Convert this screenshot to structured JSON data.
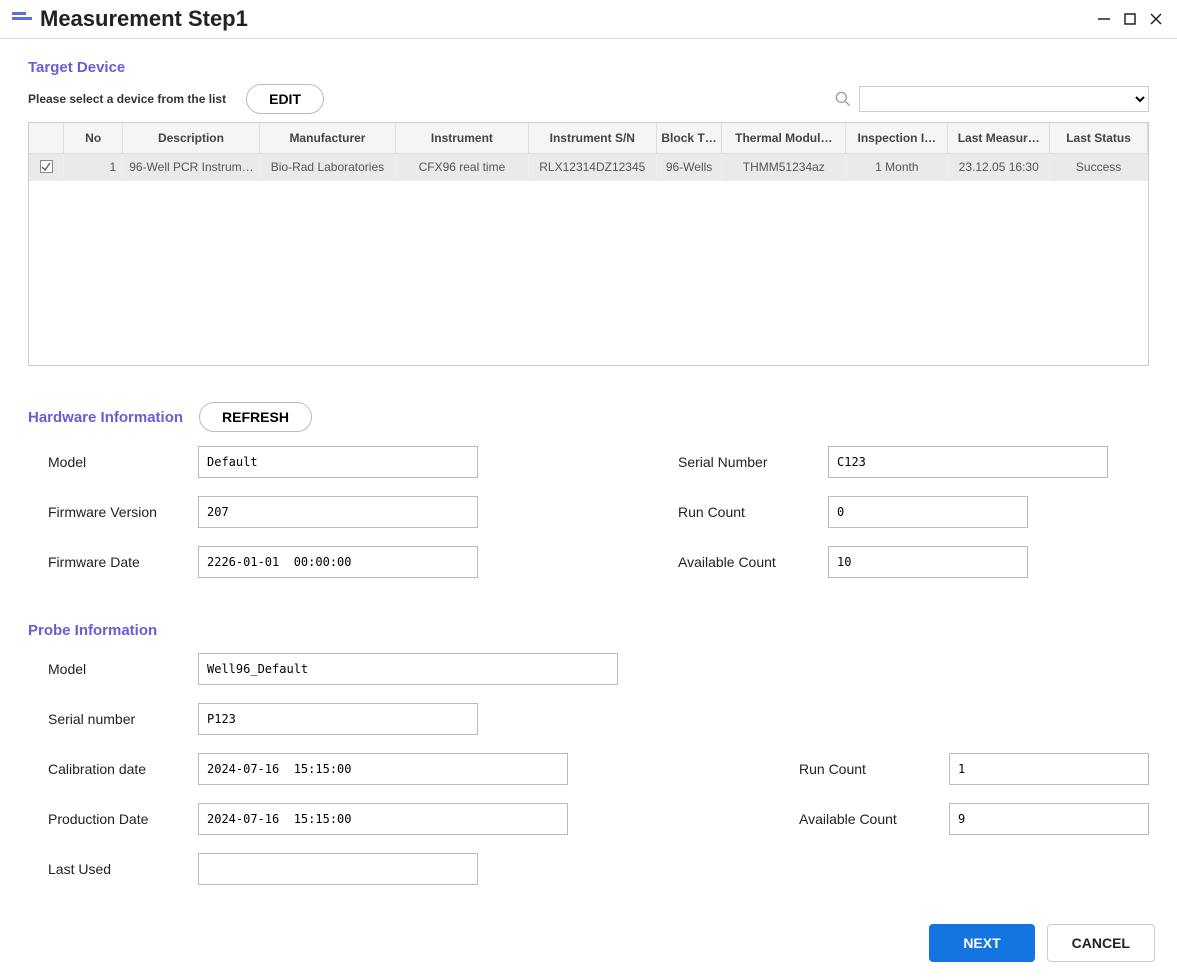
{
  "titlebar": {
    "title": "Measurement Step1"
  },
  "target": {
    "section_title": "Target Device",
    "instruction": "Please select a device from the list",
    "edit_button": "EDIT"
  },
  "table": {
    "headers": {
      "no": "No",
      "description": "Description",
      "manufacturer": "Manufacturer",
      "instrument": "Instrument",
      "instrument_sn": "Instrument S/N",
      "block_type": "Block T…",
      "thermal_module": "Thermal Modul…",
      "inspection": "Inspection I…",
      "last_measure": "Last Measur…",
      "last_status": "Last Status"
    },
    "rows": [
      {
        "checked": true,
        "no": "1",
        "description": "96-Well PCR Instrum…",
        "manufacturer": "Bio-Rad Laboratories",
        "instrument": "CFX96 real time",
        "instrument_sn": "RLX12314DZ12345",
        "block_type": "96-Wells",
        "thermal_module": "THMM51234az",
        "inspection": "1 Month",
        "last_measure": "23.12.05 16:30",
        "last_status": "Success"
      }
    ]
  },
  "hardware": {
    "section_title": "Hardware Information",
    "refresh_button": "REFRESH",
    "labels": {
      "model": "Model",
      "serial_number": "Serial Number",
      "firmware_version": "Firmware Version",
      "run_count": "Run Count",
      "firmware_date": "Firmware Date",
      "available_count": "Available Count"
    },
    "values": {
      "model": "Default",
      "serial_number": "C123",
      "firmware_version": "207",
      "run_count": "0",
      "firmware_date": "2226-01-01  00:00:00",
      "available_count": "10"
    }
  },
  "probe": {
    "section_title": "Probe Information",
    "labels": {
      "model": "Model",
      "serial_number": "Serial number",
      "calibration_date": "Calibration date",
      "run_count": "Run Count",
      "production_date": "Production Date",
      "available_count": "Available Count",
      "last_used": "Last Used"
    },
    "values": {
      "model": "Well96_Default",
      "serial_number": "P123",
      "calibration_date": "2024-07-16  15:15:00",
      "run_count": "1",
      "production_date": "2024-07-16  15:15:00",
      "available_count": "9",
      "last_used": ""
    }
  },
  "footer": {
    "next": "NEXT",
    "cancel": "CANCEL"
  }
}
